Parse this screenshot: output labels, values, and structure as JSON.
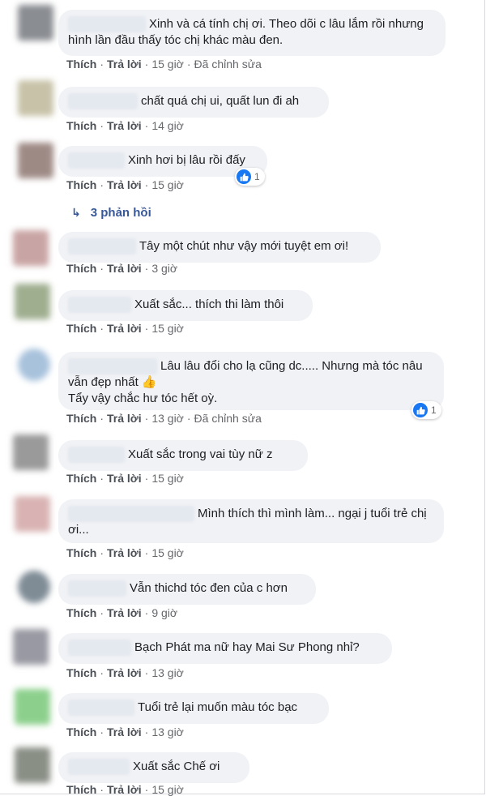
{
  "labels": {
    "like": "Thích",
    "reply": "Trả lời",
    "edited": "Đã chỉnh sửa"
  },
  "comments": [
    {
      "text": "Xinh và cá tính chị ơi. Theo dõi c lâu lắm rồi nhưng hình lần đầu thấy tóc chị khác màu đen.",
      "time": "15 giờ",
      "edited": true
    },
    {
      "text": "chất quá chị ui, quất lun đi ah",
      "time": "14 giờ"
    },
    {
      "text": "Xinh hơi bị lâu rồi đấy",
      "time": "15 giờ",
      "reactions": "1"
    },
    {
      "text": "Tây một chút như vậy mới tuyệt em ơi!",
      "time": "3 giờ"
    },
    {
      "text": "Xuất sắc... thích thi làm thôi",
      "time": "15 giờ"
    },
    {
      "text": "Lâu lâu đổi cho lạ cũng dc..... Nhưng mà tóc nâu vẫn đẹp nhất",
      "text2": "Tẩy vậy chắc hư tóc hết oỳ.",
      "emoji": "👍",
      "time": "13 giờ",
      "edited": true,
      "reactions": "1"
    },
    {
      "text": "Xuất sắc trong vai tùy nữ z",
      "time": "15 giờ"
    },
    {
      "text": "Mình thích thì mình làm... ngại j tuổi trẻ chị ơi...",
      "time": "15 giờ"
    },
    {
      "text": "Vẫn thichd tóc đen của c hơn",
      "time": "9 giờ"
    },
    {
      "text": "Bạch Phát ma nữ hay Mai Sư Phong nhỉ?",
      "time": "13 giờ"
    },
    {
      "text": "Tuổi trẻ lại muốn màu tóc bạc",
      "time": "13 giờ"
    },
    {
      "text": "Xuất sắc Chế ơi",
      "time": "15 giờ"
    }
  ],
  "replies_link": "3 phản hồi",
  "colors": {
    "bubble": "#f0f2f5",
    "link": "#385898",
    "meta": "#65676b",
    "like_blue": "#1877f2"
  }
}
